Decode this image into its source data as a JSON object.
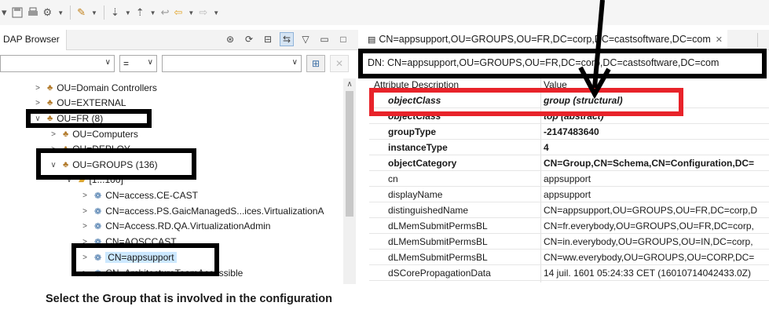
{
  "toolbar": {
    "icons": [
      "dropdown-icon",
      "save-icon",
      "print-icon",
      "settings-icon",
      "pin-icon",
      "next-annotation-icon",
      "previous-annotation-icon",
      "last-edit-icon",
      "back-icon",
      "forward-icon"
    ]
  },
  "left_view": {
    "tab_label": "DAP Browser",
    "filter": {
      "attribute_value": "",
      "operator_value": "=",
      "text_value": ""
    },
    "tree": [
      {
        "label": "OU=Domain Controllers",
        "type": "ou",
        "expanded": false,
        "selected": false
      },
      {
        "label": "OU=EXTERNAL",
        "type": "ou",
        "expanded": false,
        "selected": false
      },
      {
        "label": "OU=FR (8)",
        "type": "ou",
        "expanded": true,
        "selected": false
      },
      {
        "label": "OU=Computers",
        "type": "ou",
        "expanded": false,
        "selected": false
      },
      {
        "label": "OU=DEPLOY",
        "type": "ou",
        "expanded": false,
        "selected": false
      },
      {
        "label": "OU=GROUPS (136)",
        "type": "ou",
        "expanded": true,
        "selected": false
      },
      {
        "label": "[1...100]",
        "type": "folder",
        "expanded": true,
        "selected": false
      },
      {
        "label": "CN=access.CE-CAST",
        "type": "group",
        "expanded": false,
        "selected": false
      },
      {
        "label": "CN=access.PS.GaicManagedS...ices.VirtualizationA",
        "type": "group",
        "expanded": false,
        "selected": false
      },
      {
        "label": "CN=Access.RD.QA.VirtualizationAdmin",
        "type": "group",
        "expanded": false,
        "selected": false
      },
      {
        "label": "CN=AOSCCAST",
        "type": "group",
        "expanded": false,
        "selected": false
      },
      {
        "label": "CN=appsupport",
        "type": "group",
        "expanded": false,
        "selected": true
      },
      {
        "label": "CN=ArchitectureTeamAccessible",
        "type": "group",
        "expanded": false,
        "selected": false
      }
    ]
  },
  "caption": "Select the Group that is involved in the configuration",
  "editor": {
    "tab_label": "CN=appsupport,OU=GROUPS,OU=FR,DC=corp,DC=castsoftware,DC=com",
    "dn_label": "DN: CN=appsupport,OU=GROUPS,OU=FR,DC=corp,DC=castsoftware,DC=com",
    "columns": [
      "Attribute Description",
      "Value"
    ],
    "rows": [
      {
        "attr": "objectClass",
        "value": "group (structural)",
        "style": "italic"
      },
      {
        "attr": "objectClass",
        "value": "top (abstract)",
        "style": "italic"
      },
      {
        "attr": "groupType",
        "value": "-2147483640",
        "style": "bold"
      },
      {
        "attr": "instanceType",
        "value": "4",
        "style": "bold"
      },
      {
        "attr": "objectCategory",
        "value": "CN=Group,CN=Schema,CN=Configuration,DC=",
        "style": "bold"
      },
      {
        "attr": "cn",
        "value": "appsupport",
        "style": "normal"
      },
      {
        "attr": "displayName",
        "value": "appsupport",
        "style": "normal"
      },
      {
        "attr": "distinguishedName",
        "value": "CN=appsupport,OU=GROUPS,OU=FR,DC=corp,D",
        "style": "normal"
      },
      {
        "attr": "dLMemSubmitPermsBL",
        "value": "CN=fr.everybody,OU=GROUPS,OU=FR,DC=corp,",
        "style": "normal"
      },
      {
        "attr": "dLMemSubmitPermsBL",
        "value": "CN=in.everybody,OU=GROUPS,OU=IN,DC=corp,",
        "style": "normal"
      },
      {
        "attr": "dLMemSubmitPermsBL",
        "value": "CN=ww.everybody,OU=GROUPS,OU=CORP,DC=",
        "style": "normal"
      },
      {
        "attr": "dSCorePropagationData",
        "value": "14 juil. 1601 05:24:33 CET (16010714042433.0Z)",
        "style": "normal"
      }
    ]
  },
  "colors": {
    "annotation_black": "#000000",
    "annotation_red": "#e8232a",
    "selection": "#cce8ff"
  }
}
